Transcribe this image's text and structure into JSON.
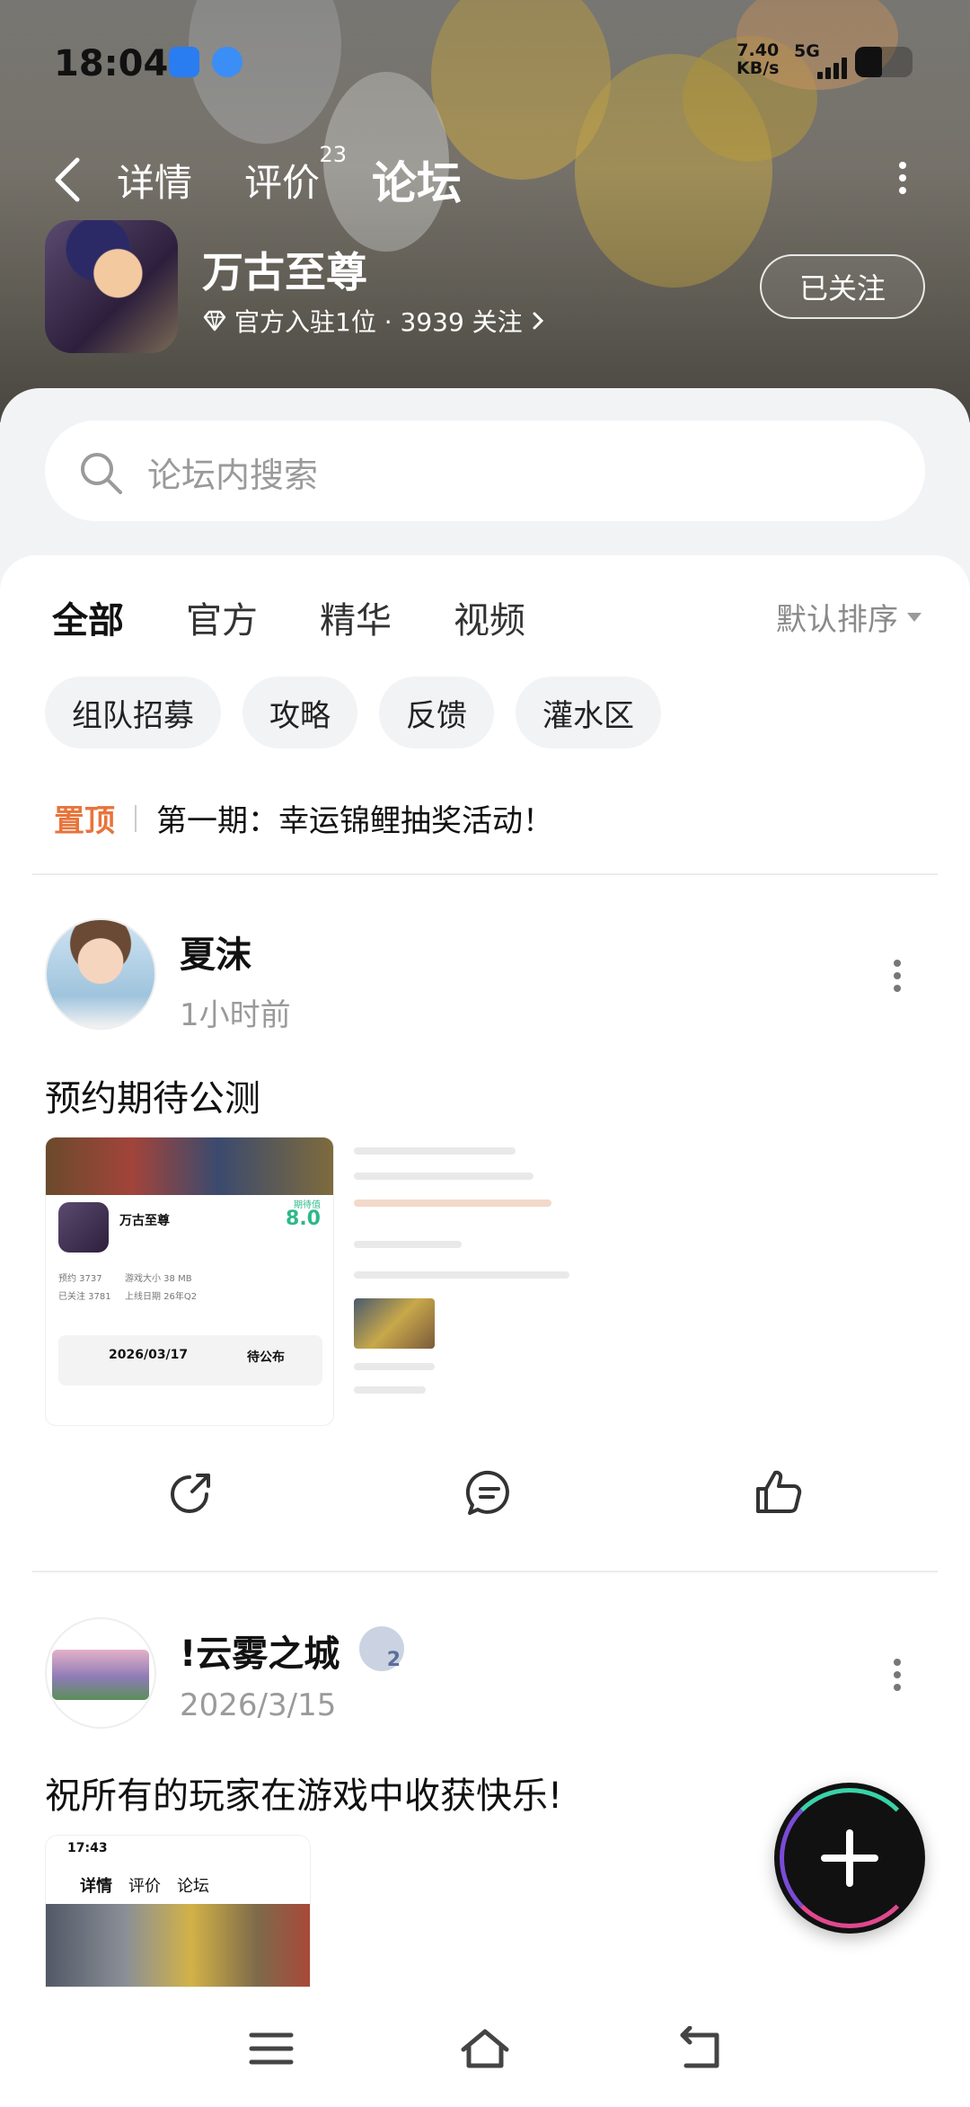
{
  "status_bar": {
    "time": "18:04",
    "net_speed_value": "7.40",
    "net_speed_unit": "KB/s",
    "network": "5G"
  },
  "nav": {
    "tabs": [
      {
        "label": "详情"
      },
      {
        "label": "评价",
        "count": "23"
      },
      {
        "label": "论坛"
      }
    ],
    "active_tab": "论坛"
  },
  "app": {
    "name": "万古至尊",
    "meta": "官方入驻1位 · 3939 关注",
    "follow_label": "已关注"
  },
  "search": {
    "placeholder": "论坛内搜索"
  },
  "filter_tabs": [
    {
      "label": "全部"
    },
    {
      "label": "官方"
    },
    {
      "label": "精华"
    },
    {
      "label": "视频"
    }
  ],
  "sort_label": "默认排序",
  "chips": [
    {
      "label": "组队招募"
    },
    {
      "label": "攻略"
    },
    {
      "label": "反馈"
    },
    {
      "label": "灌水区"
    }
  ],
  "pinned": {
    "tag": "置顶",
    "title": "第一期：幸运锦鲤抽奖活动！"
  },
  "posts": [
    {
      "author": "夏沫",
      "time": "1小时前",
      "text": "预约期待公测",
      "screenshot": {
        "game_name": "万古至尊",
        "score_label": "期待值",
        "score": "8.0",
        "stats": [
          "预约 3737",
          "游戏大小 38 MB",
          "已关注 3781",
          "上线日期 26年Q2"
        ],
        "test_date": "2026/03/17",
        "test_status": "待公布"
      }
    },
    {
      "author": "!云雾之城",
      "badge_level": "2",
      "time": "2026/3/15",
      "text": "祝所有的玩家在游戏中收获快乐!",
      "screenshot": {
        "time": "17:43",
        "tabs": [
          "详情",
          "评价",
          "论坛"
        ]
      }
    }
  ],
  "colors": {
    "accent": "#36cfa0",
    "pinned_tag": "#e8743b",
    "score": "#2eb88a"
  }
}
